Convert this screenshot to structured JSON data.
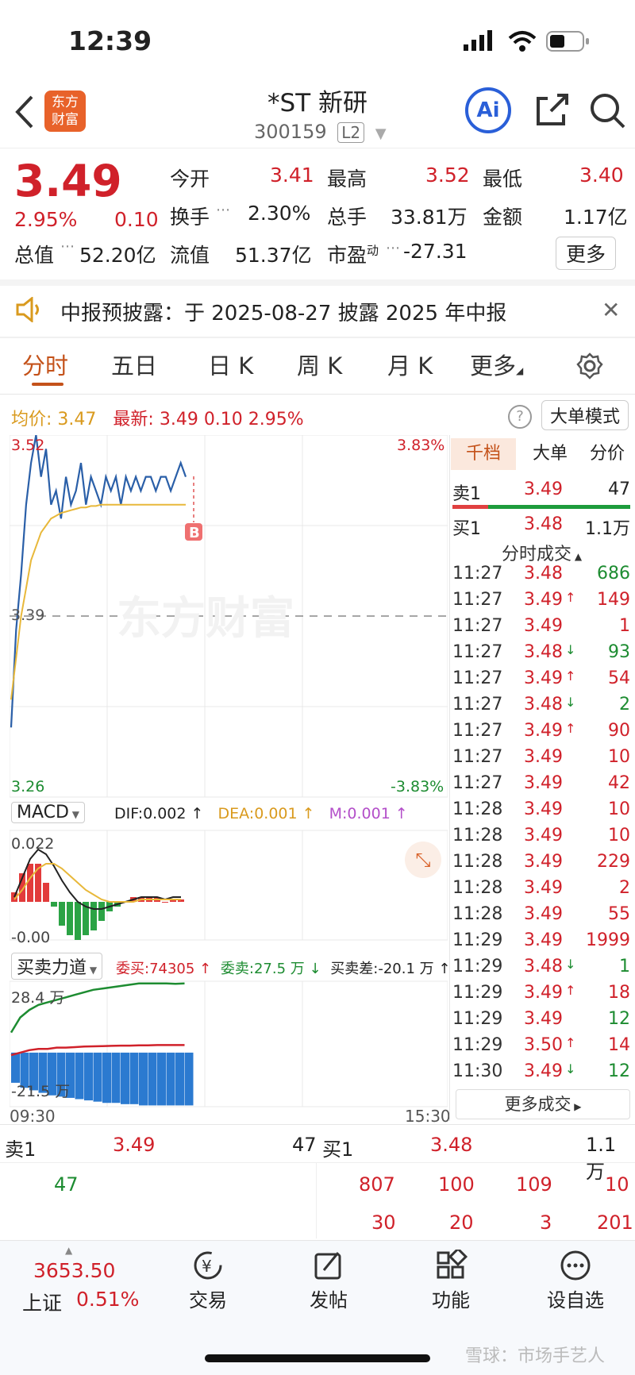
{
  "status_bar": {
    "time": "12:39"
  },
  "header": {
    "logo_text": "东方财富",
    "stock_name": "*ST 新研",
    "stock_code": "300159",
    "level_badge": "L2"
  },
  "quote": {
    "price": "3.49",
    "change_pct": "2.95%",
    "change": "0.10",
    "open_label": "今开",
    "open": "3.41",
    "high_label": "最高",
    "high": "3.52",
    "low_label": "最低",
    "low": "3.40",
    "turnover_label": "换手",
    "turnover": "2.30%",
    "volume_label": "总手",
    "volume": "33.81万",
    "amount_label": "金额",
    "amount": "1.17亿",
    "mcap_label": "总值",
    "mcap": "52.20亿",
    "float_label": "流值",
    "float_cap": "51.37亿",
    "pe_label": "市盈",
    "pe_sup": "动",
    "pe": "-27.31",
    "more_label": "更多"
  },
  "notice": {
    "text": "中报预披露：于 2025-08-27 披露 2025 年中报"
  },
  "tabs": [
    "分时",
    "五日",
    "日 K",
    "周 K",
    "月 K",
    "更多"
  ],
  "chart_info": {
    "avg_label": "均价:",
    "avg": "3.47",
    "latest_label": "最新:",
    "latest": "3.49",
    "latest_chg": "0.10",
    "latest_pct": "2.95%",
    "mode_button": "大单模式"
  },
  "axis": {
    "top_price": "3.52",
    "top_pct": "3.83%",
    "mid_price": "3.39",
    "bottom_price": "3.26",
    "bottom_pct": "-3.83%",
    "start_time": "09:30",
    "end_time": "15:30",
    "watermark": "东方财富",
    "b_marker": "B"
  },
  "chart_data": [
    {
      "type": "line",
      "title": "",
      "ylim": [
        3.26,
        3.52
      ],
      "series": [
        {
          "name": "",
          "color": "#2a5fa8",
          "values": [
            3.31,
            3.38,
            3.42,
            3.47,
            3.5,
            3.52,
            3.49,
            3.51,
            3.47,
            3.48,
            3.46,
            3.49,
            3.47,
            3.48,
            3.5,
            3.47,
            3.49,
            3.48,
            3.47,
            3.49,
            3.48,
            3.49,
            3.47,
            3.49,
            3.48,
            3.49,
            3.48,
            3.49,
            3.49,
            3.48,
            3.49,
            3.49,
            3.48,
            3.49,
            3.5,
            3.49
          ]
        },
        {
          "name": "",
          "color": "#e8b83a",
          "values": [
            3.33,
            3.36,
            3.39,
            3.41,
            3.43,
            3.44,
            3.45,
            3.455,
            3.46,
            3.462,
            3.464,
            3.465,
            3.466,
            3.467,
            3.468,
            3.468,
            3.469,
            3.469,
            3.47,
            3.47,
            3.47,
            3.47,
            3.47,
            3.47,
            3.47,
            3.47,
            3.47,
            3.47,
            3.47,
            3.47,
            3.47,
            3.47,
            3.47,
            3.47,
            3.47,
            3.47
          ]
        }
      ]
    },
    {
      "type": "bar",
      "title": "MACD",
      "series": [
        {
          "name": "DIF",
          "color": "#222222",
          "values": [
            0.002,
            0.01,
            0.018,
            0.022,
            0.02,
            0.015,
            0.009,
            0.004,
            0.0,
            -0.002,
            -0.003,
            -0.003,
            -0.002,
            -0.001,
            0.0,
            0.001,
            0.002,
            0.002,
            0.002,
            0.001,
            0.002,
            0.002
          ]
        },
        {
          "name": "DEA",
          "color": "#e8b83a",
          "values": [
            0.001,
            0.005,
            0.01,
            0.014,
            0.016,
            0.016,
            0.014,
            0.011,
            0.008,
            0.005,
            0.003,
            0.001,
            0.0,
            0.0,
            0.0,
            0.0,
            0.001,
            0.001,
            0.001,
            0.001,
            0.001,
            0.001
          ]
        },
        {
          "name": "M",
          "color": "#b34fc9",
          "values": [
            0.004,
            0.012,
            0.016,
            0.016,
            0.008,
            -0.002,
            -0.01,
            -0.014,
            -0.016,
            -0.014,
            -0.012,
            -0.008,
            -0.004,
            -0.002,
            0.0,
            0.002,
            0.002,
            0.002,
            0.002,
            0.0,
            0.001,
            0.001
          ]
        }
      ]
    },
    {
      "type": "area",
      "title": "买卖力道",
      "ylim": [
        -21.5,
        28.4
      ],
      "series": [
        {
          "name": "委买",
          "color": "#1d8c31",
          "values": [
            8,
            14,
            17,
            19,
            20,
            21,
            22,
            23,
            24,
            25,
            25.5,
            26,
            26.5,
            27,
            27.5,
            27.5,
            27.5,
            27.5,
            27.4,
            27.5
          ]
        },
        {
          "name": "委卖",
          "color": "#d0212a",
          "values": [
            -1,
            0,
            1,
            1.5,
            1.5,
            2,
            2,
            2.2,
            2.4,
            2.5,
            2.6,
            2.7,
            2.8,
            2.8,
            2.9,
            2.9,
            3,
            3,
            3,
            3
          ]
        },
        {
          "name": "买卖差",
          "color": "#2b7ad0",
          "values": [
            -12,
            -14,
            -15,
            -16,
            -17,
            -17.5,
            -18,
            -18.5,
            -19,
            -19.5,
            -20,
            -20,
            -20.5,
            -20.5,
            -21,
            -21,
            -21,
            -21,
            -21,
            -21
          ]
        }
      ]
    }
  ],
  "macd": {
    "label": "MACD",
    "dif": "DIF:0.002 ↑",
    "dea": "DEA:0.001 ↑",
    "m": "M:0.001 ↑",
    "top": "0.022",
    "bottom": "-0.00"
  },
  "force": {
    "label": "买卖力道",
    "buy": "委买:74305 ↑",
    "sell": "委卖:27.5 万 ↓",
    "diff": "买卖差:-20.1 万 ↑",
    "top": "28.4 万",
    "bottom": "-21.5 万"
  },
  "side_tabs": [
    "千档",
    "大单",
    "分价"
  ],
  "side_book": {
    "sell_label": "卖1",
    "sell_price": "3.49",
    "sell_vol": "47",
    "buy_label": "买1",
    "buy_price": "3.48",
    "buy_vol": "1.1万"
  },
  "ticks_header": "分时成交",
  "ticks": [
    {
      "time": "11:27",
      "price": "3.48",
      "arrow": "",
      "vol": "686",
      "c": "green"
    },
    {
      "time": "11:27",
      "price": "3.49",
      "arrow": "↑",
      "vol": "149",
      "c": "red"
    },
    {
      "time": "11:27",
      "price": "3.49",
      "arrow": "",
      "vol": "1",
      "c": "red"
    },
    {
      "time": "11:27",
      "price": "3.48",
      "arrow": "↓",
      "vol": "93",
      "c": "green"
    },
    {
      "time": "11:27",
      "price": "3.49",
      "arrow": "↑",
      "vol": "54",
      "c": "red"
    },
    {
      "time": "11:27",
      "price": "3.48",
      "arrow": "↓",
      "vol": "2",
      "c": "green"
    },
    {
      "time": "11:27",
      "price": "3.49",
      "arrow": "↑",
      "vol": "90",
      "c": "red"
    },
    {
      "time": "11:27",
      "price": "3.49",
      "arrow": "",
      "vol": "10",
      "c": "red"
    },
    {
      "time": "11:27",
      "price": "3.49",
      "arrow": "",
      "vol": "42",
      "c": "red"
    },
    {
      "time": "11:28",
      "price": "3.49",
      "arrow": "",
      "vol": "10",
      "c": "red"
    },
    {
      "time": "11:28",
      "price": "3.49",
      "arrow": "",
      "vol": "10",
      "c": "red"
    },
    {
      "time": "11:28",
      "price": "3.49",
      "arrow": "",
      "vol": "229",
      "c": "red"
    },
    {
      "time": "11:28",
      "price": "3.49",
      "arrow": "",
      "vol": "2",
      "c": "red"
    },
    {
      "time": "11:28",
      "price": "3.49",
      "arrow": "",
      "vol": "55",
      "c": "red"
    },
    {
      "time": "11:29",
      "price": "3.49",
      "arrow": "",
      "vol": "1999",
      "c": "red"
    },
    {
      "time": "11:29",
      "price": "3.48",
      "arrow": "↓",
      "vol": "1",
      "c": "green"
    },
    {
      "time": "11:29",
      "price": "3.49",
      "arrow": "↑",
      "vol": "18",
      "c": "red"
    },
    {
      "time": "11:29",
      "price": "3.49",
      "arrow": "",
      "vol": "12",
      "c": "green"
    },
    {
      "time": "11:29",
      "price": "3.50",
      "arrow": "↑",
      "vol": "14",
      "c": "red"
    },
    {
      "time": "11:30",
      "price": "3.49",
      "arrow": "↓",
      "vol": "12",
      "c": "green"
    }
  ],
  "more_trades": "更多成交",
  "orderbook": {
    "sell_label": "卖1",
    "sell_price": "3.49",
    "sell_vol": "47",
    "buy_label": "买1",
    "buy_price": "3.48",
    "buy_vol": "1.1万",
    "sell_queue": [
      "47"
    ],
    "buy_queue": [
      "807",
      "100",
      "109",
      "10",
      "30",
      "20",
      "3",
      "201"
    ]
  },
  "bottom_nav": {
    "index_value": "3653.50",
    "index_name": "上证",
    "index_pct": "0.51%",
    "items": [
      "交易",
      "发帖",
      "功能",
      "设自选"
    ]
  },
  "watermark_footer": "雪球：市场手艺人"
}
